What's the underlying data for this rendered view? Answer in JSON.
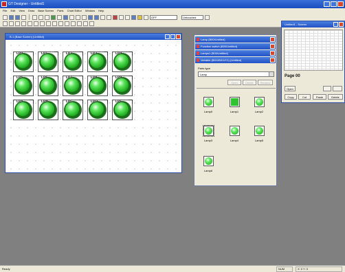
{
  "app": {
    "title": "GT Designer - Untitled1"
  },
  "menu": [
    "File",
    "Edit",
    "View",
    "Draw",
    "Base Screen",
    "Parts",
    "Chart Editor",
    "Window",
    "Help"
  ],
  "toolbar": {
    "combo1": "OFF",
    "combo2": "Untouched"
  },
  "base_window": {
    "title": "B-1 (Base Screen) (Untitled)"
  },
  "lamps": [
    {
      "label": "LP0"
    },
    {
      "label": "LP1"
    },
    {
      "label": "LP2"
    },
    {
      "label": "LP3"
    },
    {
      "label": "LP4"
    },
    {
      "label": "LP5"
    },
    {
      "label": "LP6"
    },
    {
      "label": "LP7"
    },
    {
      "label": "LP8"
    },
    {
      "label": "LP9"
    },
    {
      "label": "LPA"
    },
    {
      "label": "LPB"
    },
    {
      "label": "LPC"
    },
    {
      "label": "LPD"
    },
    {
      "label": "LPE"
    }
  ],
  "util_window": {
    "title": "Untitled1 - Screen",
    "page_label": "Page 00",
    "buttons": {
      "open": "Open",
      "copy": "Copy",
      "cut": "Cut",
      "paste": "Paste",
      "delete": "Delete"
    }
  },
  "panel": {
    "docks": [
      "Lamp (B00/Untitled)",
      "Function switch (B00/Untitled)",
      "Lamps1 (B00/Untitled)",
      "Variable (B0/1/B0/1/C1) (Untitled)"
    ],
    "parts_type_label": "Parts type",
    "parts_type_value": "Lamp",
    "buttons": [
      "Open",
      "Delete",
      "Rename"
    ],
    "items": [
      {
        "name": "Lamp0",
        "shape": "round"
      },
      {
        "name": "Lamp1",
        "shape": "square"
      },
      {
        "name": "Lamp2",
        "shape": "round"
      },
      {
        "name": "Lamp3",
        "shape": "round"
      },
      {
        "name": "Lamp4",
        "shape": "round"
      },
      {
        "name": "Lamp5",
        "shape": "round"
      },
      {
        "name": "Lamp6",
        "shape": "round"
      }
    ]
  },
  "status": {
    "left": "Ready",
    "cell1": "NUM",
    "cell2": "X: 0  Y: 0"
  }
}
